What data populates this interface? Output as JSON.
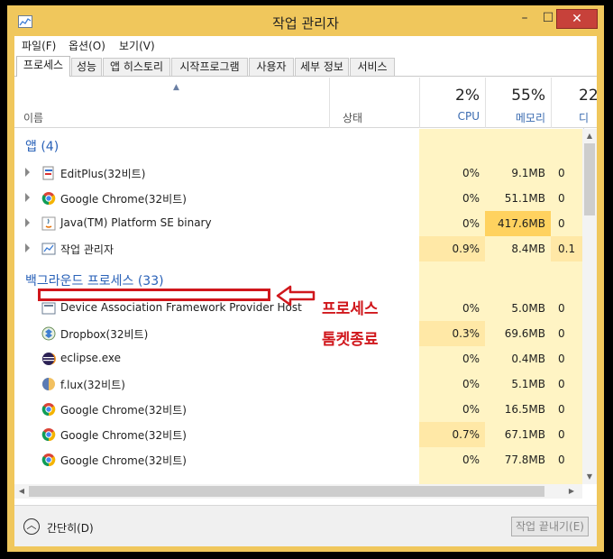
{
  "window": {
    "title": "작업 관리자"
  },
  "menu": [
    "파일(F)",
    "옵션(O)",
    "보기(V)"
  ],
  "tabs": [
    {
      "label": "프로세스",
      "active": true
    },
    {
      "label": "성능",
      "active": false
    },
    {
      "label": "앱 히스토리",
      "active": false
    },
    {
      "label": "시작프로그램",
      "active": false
    },
    {
      "label": "사용자",
      "active": false
    },
    {
      "label": "세부 정보",
      "active": false
    },
    {
      "label": "서비스",
      "active": false
    }
  ],
  "columns": {
    "name": "이름",
    "status": "상태",
    "cpu": {
      "pct": "2%",
      "label": "CPU"
    },
    "memory": {
      "pct": "55%",
      "label": "메모리"
    },
    "disk": {
      "pct": "22",
      "label": "디스"
    }
  },
  "groups": [
    {
      "label": "앱 (4)"
    },
    {
      "label": "백그라운드 프로세스 (33)"
    }
  ],
  "apps": [
    {
      "name": "EditPlus(32비트)",
      "icon": "editplus-icon",
      "cpu": "0%",
      "mem": "9.1MB",
      "disk": "0"
    },
    {
      "name": "Google Chrome(32비트)",
      "icon": "chrome-icon",
      "cpu": "0%",
      "mem": "51.1MB",
      "disk": "0"
    },
    {
      "name": "Java(TM) Platform SE binary",
      "icon": "java-icon",
      "cpu": "0%",
      "mem": "417.6MB",
      "disk": "0"
    },
    {
      "name": "작업 관리자",
      "icon": "taskmgr-icon",
      "cpu": "0.9%",
      "mem": "8.4MB",
      "disk": "0.1"
    }
  ],
  "background": [
    {
      "name": "Device Association Framework Provider Host",
      "icon": "service-icon",
      "cpu": "0%",
      "mem": "5.0MB",
      "disk": "0"
    },
    {
      "name": "Dropbox(32비트)",
      "icon": "dropbox-icon",
      "cpu": "0.3%",
      "mem": "69.6MB",
      "disk": "0"
    },
    {
      "name": "eclipse.exe",
      "icon": "eclipse-icon",
      "cpu": "0%",
      "mem": "0.4MB",
      "disk": "0"
    },
    {
      "name": "f.lux(32비트)",
      "icon": "flux-icon",
      "cpu": "0%",
      "mem": "5.1MB",
      "disk": "0"
    },
    {
      "name": "Google Chrome(32비트)",
      "icon": "chrome-icon",
      "cpu": "0%",
      "mem": "16.5MB",
      "disk": "0"
    },
    {
      "name": "Google Chrome(32비트)",
      "icon": "chrome-icon",
      "cpu": "0.7%",
      "mem": "67.1MB",
      "disk": "0"
    },
    {
      "name": "Google Chrome(32비트)",
      "icon": "chrome-icon",
      "cpu": "0%",
      "mem": "77.8MB",
      "disk": "0"
    }
  ],
  "footer": {
    "collapse": "간단히(D)",
    "end_task": "작업 끝내기(E)"
  },
  "annotation": {
    "line1": "프로세스",
    "line2": "톰켓종료"
  },
  "colors": {
    "accent": "#2a62b8",
    "heat_light": "#fff4c4",
    "heat_mid": "#ffe8a6",
    "heat_high": "#ffd25f",
    "annotation": "#d0171c",
    "frame": "#f0c75c"
  }
}
